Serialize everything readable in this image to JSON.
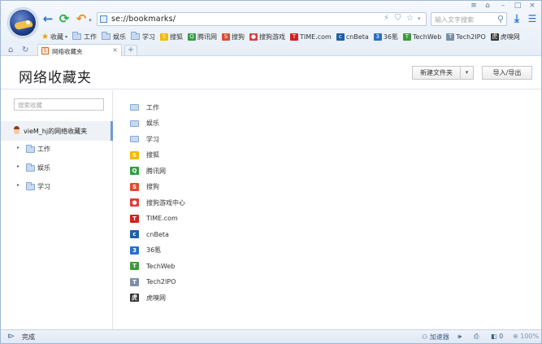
{
  "window": {
    "controls": [
      "≡",
      "⌂",
      "–",
      "□",
      "×"
    ]
  },
  "nav": {
    "back_icon": "arrow-left-icon",
    "refresh_icon": "refresh-icon",
    "undo_icon": "undo-icon",
    "address_url": "se://bookmarks/",
    "search_placeholder": "输入文字搜索"
  },
  "bookmark_bar": {
    "favorites_label": "收藏",
    "items": [
      {
        "label": "工作",
        "icon": "folder-icon"
      },
      {
        "label": "娱乐",
        "icon": "folder-icon"
      },
      {
        "label": "学习",
        "icon": "folder-icon"
      },
      {
        "label": "搜狐",
        "icon": "sohu-icon",
        "color": "#f5b800",
        "glyph": "S"
      },
      {
        "label": "腾讯网",
        "icon": "qq-icon",
        "color": "#2f9e44",
        "glyph": "Q"
      },
      {
        "label": "搜狗",
        "icon": "sogou-icon",
        "color": "#e04a2f",
        "glyph": "S"
      },
      {
        "label": "搜狗游戏",
        "icon": "sogou-game-icon",
        "color": "#e03b3b",
        "glyph": "●"
      },
      {
        "label": "TIME.com",
        "icon": "time-icon",
        "color": "#d42020",
        "glyph": "T"
      },
      {
        "label": "cnBeta",
        "icon": "cnbeta-icon",
        "color": "#1e5fa8",
        "glyph": "c"
      },
      {
        "label": "36氪",
        "icon": "36kr-icon",
        "color": "#2a6fc9",
        "glyph": "3"
      },
      {
        "label": "TechWeb",
        "icon": "techweb-icon",
        "color": "#3c9a3c",
        "glyph": "T"
      },
      {
        "label": "Tech2IPO",
        "icon": "tech2ipo-icon",
        "color": "#7a8fa8",
        "glyph": "T"
      },
      {
        "label": "虎嗅网",
        "icon": "huxiu-icon",
        "color": "#333333",
        "glyph": "虎"
      }
    ]
  },
  "tabs": {
    "active_label": "网络收藏夹",
    "new_tab": "+"
  },
  "header": {
    "title": "网络收藏夹",
    "new_folder_label": "新建文件夹",
    "import_export_label": "导入/导出"
  },
  "sidebar": {
    "search_placeholder": "搜索收藏",
    "root_label": "vieM_hj的网络收藏夹",
    "folders": [
      "工作",
      "娱乐",
      "学习"
    ]
  },
  "main": {
    "items": [
      {
        "label": "工作",
        "icon": "folder-icon",
        "type": "folder"
      },
      {
        "label": "娱乐",
        "icon": "folder-icon",
        "type": "folder"
      },
      {
        "label": "学习",
        "icon": "folder-icon",
        "type": "folder"
      },
      {
        "label": "搜狐",
        "icon": "sohu-icon",
        "color": "#f5b800",
        "glyph": "S"
      },
      {
        "label": "腾讯网",
        "icon": "qq-icon",
        "color": "#2f9e44",
        "glyph": "Q"
      },
      {
        "label": "搜狗",
        "icon": "sogou-icon",
        "color": "#e04a2f",
        "glyph": "S"
      },
      {
        "label": "搜狗游戏中心",
        "icon": "sogou-game-icon",
        "color": "#e03b3b",
        "glyph": "●"
      },
      {
        "label": "TIME.com",
        "icon": "time-icon",
        "color": "#d42020",
        "glyph": "T"
      },
      {
        "label": "cnBeta",
        "icon": "cnbeta-icon",
        "color": "#1e5fa8",
        "glyph": "c"
      },
      {
        "label": "36氪",
        "icon": "36kr-icon",
        "color": "#2a6fc9",
        "glyph": "3"
      },
      {
        "label": "TechWeb",
        "icon": "techweb-icon",
        "color": "#3c9a3c",
        "glyph": "T"
      },
      {
        "label": "Tech2IPO",
        "icon": "tech2ipo-icon",
        "color": "#7a8fa8",
        "glyph": "T"
      },
      {
        "label": "虎嗅网",
        "icon": "huxiu-icon",
        "color": "#333333",
        "glyph": "虎"
      }
    ]
  },
  "status": {
    "text": "完成",
    "accelerator": "加速器",
    "zoom": "100%",
    "badge": "0"
  }
}
